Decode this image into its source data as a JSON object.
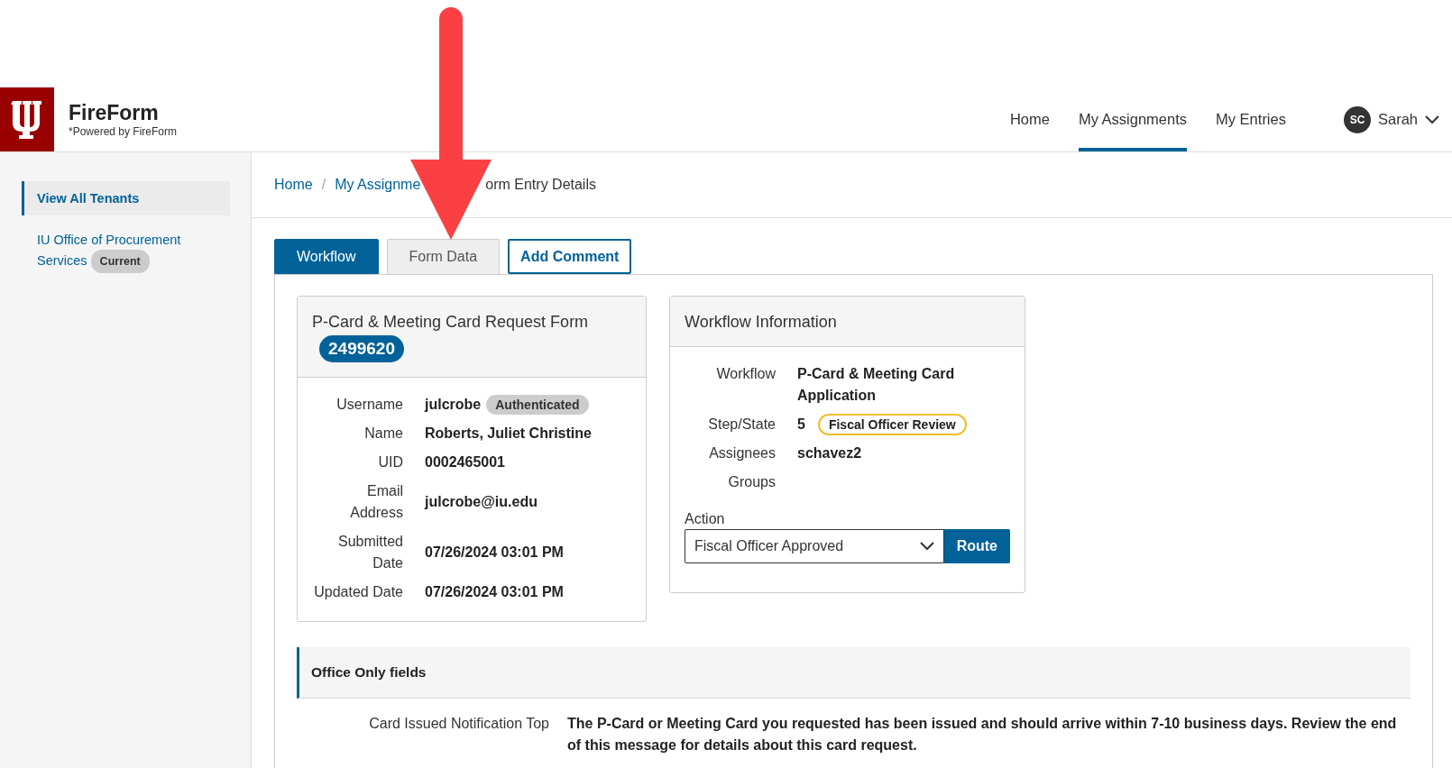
{
  "header": {
    "app_name": "FireForm",
    "tagline": "*Powered by FireForm",
    "nav": [
      {
        "label": "Home",
        "selected": false
      },
      {
        "label": "My Assignments",
        "selected": true
      },
      {
        "label": "My Entries",
        "selected": false
      }
    ],
    "user": {
      "initials": "SC",
      "name": "Sarah"
    }
  },
  "sidebar": {
    "items": [
      {
        "label": "View All Tenants",
        "selected": true
      },
      {
        "label": "IU Office of Procurement Services",
        "badge": "Current",
        "selected": false
      }
    ]
  },
  "breadcrumb": [
    {
      "label": "Home",
      "kind": "link"
    },
    {
      "label": "/",
      "kind": "separator"
    },
    {
      "label": "My Assignme",
      "kind": "link"
    },
    {
      "label": "orm Entry Details",
      "kind": "text"
    }
  ],
  "tabs": [
    {
      "label": "Workflow",
      "kind": "tab",
      "selected": true
    },
    {
      "label": "Form Data",
      "kind": "tab",
      "selected": false
    },
    {
      "label": "Add Comment",
      "kind": "button"
    }
  ],
  "form_card": {
    "title": "P-Card & Meeting Card Request Form",
    "number": "2499620",
    "fields": [
      {
        "label": "Username",
        "value": "julcrobe",
        "badge": "Authenticated"
      },
      {
        "label": "Name",
        "value": "Roberts, Juliet Christine"
      },
      {
        "label": "UID",
        "value": "0002465001"
      },
      {
        "label": "Email Address",
        "value": "julcrobe@iu.edu"
      },
      {
        "label": "Submitted Date",
        "value": "07/26/2024 03:01 PM"
      },
      {
        "label": "Updated Date",
        "value": "07/26/2024 03:01 PM"
      }
    ]
  },
  "workflow_card": {
    "title": "Workflow Information",
    "fields": [
      {
        "label": "Workflow",
        "value": "P-Card & Meeting Card Application"
      },
      {
        "label": "Step/State",
        "value": "5",
        "badge": "Fiscal Officer Review"
      },
      {
        "label": "Assignees",
        "value": "schavez2"
      },
      {
        "label": "Groups"
      }
    ],
    "action_label": "Action",
    "action_value": "Fiscal Officer Approved",
    "route_button": "Route"
  },
  "office_section": {
    "title": "Office Only fields",
    "fields": [
      {
        "label": "Card Issued Notification Top",
        "value": "The P-Card or Meeting Card you requested has been issued and should arrive within 7-10 business days. Review the end of this message for details about this card request."
      }
    ]
  }
}
